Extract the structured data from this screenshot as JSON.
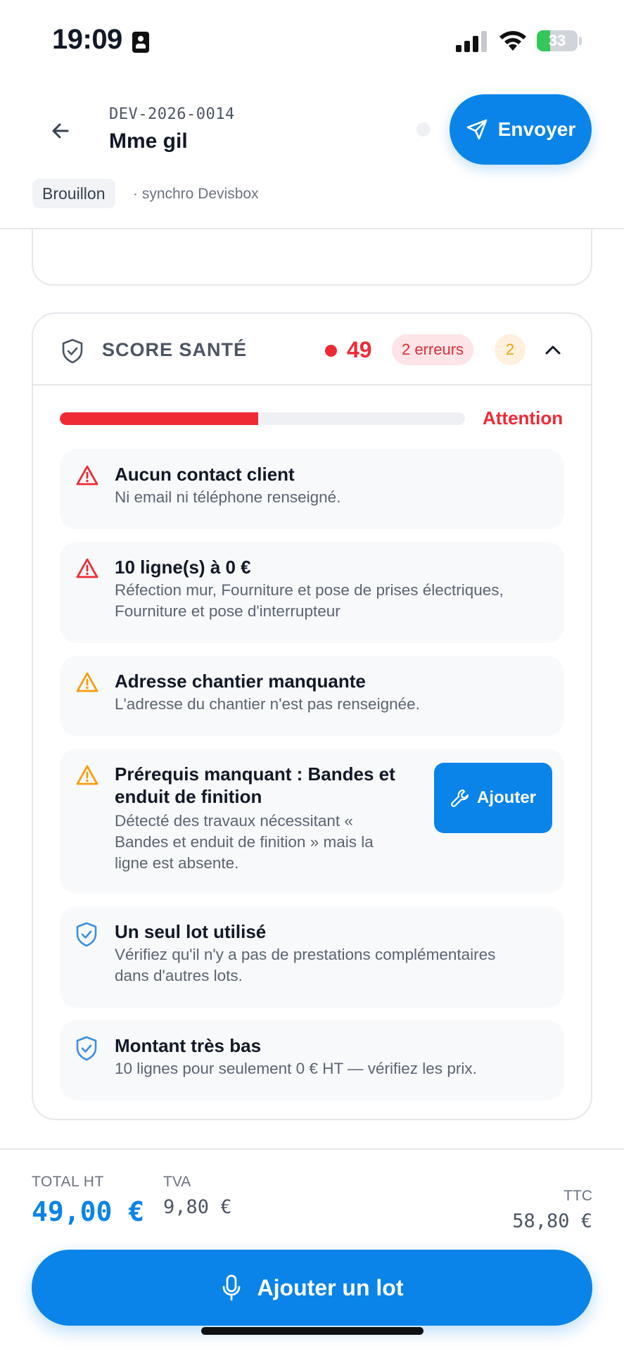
{
  "status_bar": {
    "time": "19:09",
    "battery": "33",
    "battery_level": 0.33
  },
  "header": {
    "doc_ref": "DEV-2026-0014",
    "client": "Mme gil",
    "send_label": "Envoyer",
    "status_pill": "Brouillon",
    "sync_label": "· synchro Devisbox"
  },
  "score": {
    "title": "SCORE SANTÉ",
    "value": "49",
    "value_fraction": 0.49,
    "errors_badge": "2 erreurs",
    "warnings_badge": "2",
    "progress_label": "Attention",
    "colors": {
      "error": "#ef2a35",
      "warning": "#f59e0b",
      "info": "#3b8fe0",
      "accent": "#0a84e8"
    },
    "issues": [
      {
        "level": "error",
        "icon": "alert-triangle-icon",
        "title": "Aucun contact client",
        "desc_lines": [
          "Ni email ni téléphone renseigné."
        ]
      },
      {
        "level": "error",
        "icon": "alert-triangle-icon",
        "title": "10 ligne(s) à 0 €",
        "desc_lines": [
          "Réfection mur, Fourniture et pose de prises électriques,",
          "Fourniture et pose d'interrupteur"
        ]
      },
      {
        "level": "warning",
        "icon": "alert-triangle-icon",
        "title": "Adresse chantier manquante",
        "desc_lines": [
          "L'adresse du chantier n'est pas renseignée."
        ]
      },
      {
        "level": "warning",
        "icon": "alert-triangle-icon",
        "title_lines": [
          "Prérequis manquant : Bandes et",
          "enduit de finition"
        ],
        "desc_lines": [
          "Détecté des travaux nécessitant «",
          "Bandes et enduit de finition » mais la",
          "ligne est absente."
        ],
        "action_label": "Ajouter"
      },
      {
        "level": "info",
        "icon": "shield-check-icon",
        "title": "Un seul lot utilisé",
        "desc_lines": [
          "Vérifiez qu'il n'y a pas de prestations complémentaires",
          "dans d'autres lots."
        ]
      },
      {
        "level": "info",
        "icon": "shield-check-icon",
        "title": "Montant très bas",
        "desc_lines": [
          "10 lignes pour seulement 0 € HT — vérifiez les prix."
        ]
      }
    ]
  },
  "footer": {
    "total_ht_label": "TOTAL HT",
    "total_ht": "49,00 €",
    "tva_label": "TVA",
    "tva": "9,80 €",
    "ttc_label": "TTC",
    "ttc": "58,80 €",
    "add_lot_label": "Ajouter un lot"
  }
}
